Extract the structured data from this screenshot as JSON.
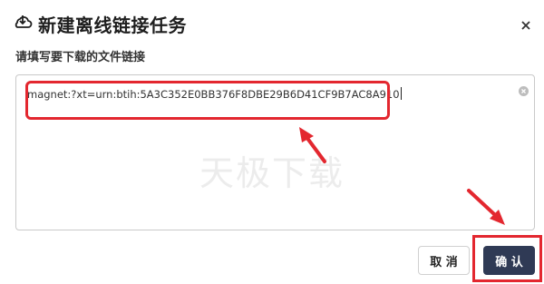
{
  "dialog": {
    "title": "新建离线链接任务",
    "subtitle": "请填写要下载的文件链接",
    "link_value": "magnet:?xt=urn:btih:5A3C352E0BB376F8DBE29B6D41CF9B7AC8A910",
    "watermark": "天极下载",
    "cancel_label": "取 消",
    "confirm_label": "确 认",
    "icons": {
      "title": "cloud-download-icon",
      "close": "close-icon",
      "clear": "clear-input-icon"
    },
    "colors": {
      "annotation": "#e3272f",
      "confirm_button": "#2f3a55"
    }
  }
}
